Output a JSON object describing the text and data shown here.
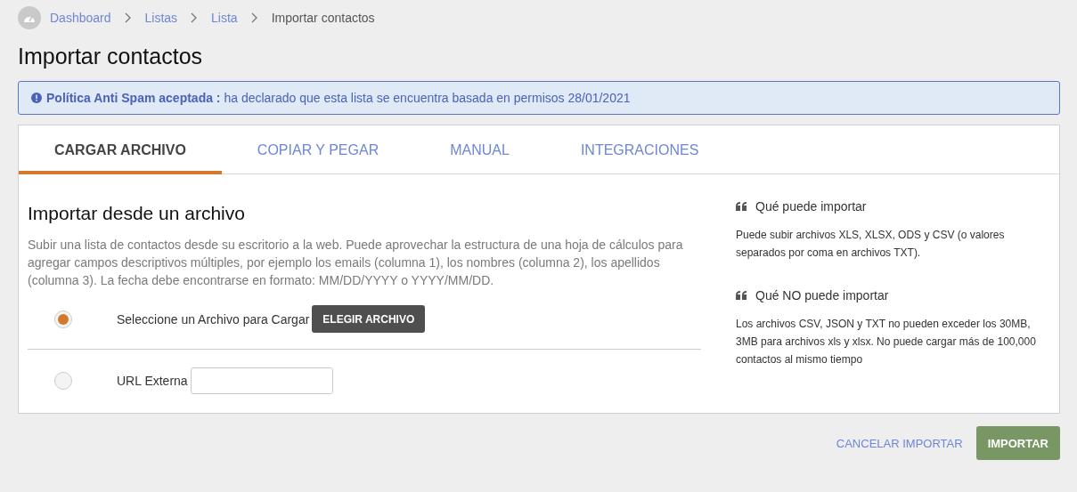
{
  "breadcrumb": [
    {
      "label": "Dashboard",
      "link": true
    },
    {
      "label": "Listas",
      "link": true
    },
    {
      "label": "Lista",
      "link": true
    },
    {
      "label": "Importar contactos",
      "link": false
    }
  ],
  "title": "Importar contactos",
  "alert": {
    "text": "**Política Anti Spam aceptada :** ha declarado que esta lista se encuentra basada en permisos 28/01/2021"
  },
  "tabs": [
    {
      "label": "CARGAR ARCHIVO",
      "selected": true
    },
    {
      "label": "COPIAR Y PEGAR",
      "selected": false
    },
    {
      "label": "MANUAL",
      "selected": false
    },
    {
      "label": "INTEGRACIONES",
      "selected": false
    }
  ],
  "section": {
    "heading": "Importar desde un archivo",
    "description": "Subir una lista de contactos desde su escritorio a la web. Puede aprovechar la estructura de una hoja de cálculos para agregar campos descriptivos múltiples, por ejemplo los emails (columna 1), los nombres (columna 2), los apellidos (columna 3). La fecha debe encontrarse en formato: MM/DD/YYYY o YYYY/MM/DD."
  },
  "options": [
    {
      "kind": "file",
      "label": "Seleccione un Archivo para Cargar",
      "button": "ELEGIR ARCHIVO",
      "selected": true
    },
    {
      "kind": "url",
      "label": "URL Externa",
      "selected": false
    }
  ],
  "info": [
    {
      "heading": "Qué puede importar",
      "text": "Puede subir archivos XLS, XLSX, ODS y CSV (o valores separados por coma en archivos TXT)."
    },
    {
      "heading": "Qué NO puede importar",
      "text": "Los archivos CSV, JSON y TXT no pueden exceder los 30MB, 3MB para archivos xls y xlsx. No puede cargar más de 100,000 contactos al mismo tiempo"
    }
  ],
  "footer": {
    "cancel": "CANCELAR IMPORTAR",
    "submit": "IMPORTAR"
  }
}
